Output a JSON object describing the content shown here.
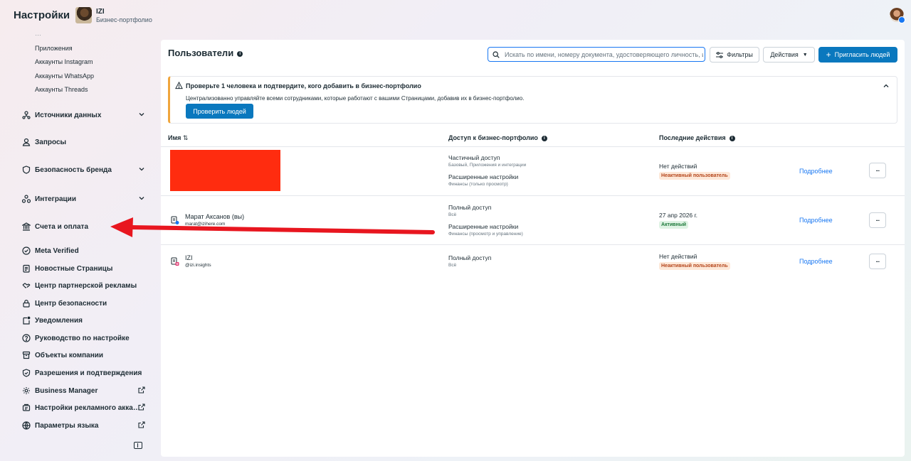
{
  "header": {
    "title": "Настройки",
    "business_name": "IZI",
    "business_type": "Бизнес-портфолио"
  },
  "sidebar": {
    "truncated_item": "…",
    "sub_items": [
      "Приложения",
      "Аккаунты Instagram",
      "Аккаунты WhatsApp",
      "Аккаунты Threads"
    ],
    "items": [
      {
        "label": "Источники данных",
        "icon": "data-sources-icon",
        "expandable": true
      },
      {
        "label": "Запросы",
        "icon": "person-icon"
      },
      {
        "label": "Безопасность бренда",
        "icon": "shield-icon",
        "expandable": true
      },
      {
        "label": "Интеграции",
        "icon": "integrations-icon",
        "expandable": true
      },
      {
        "label": "Счета и оплата",
        "icon": "bank-icon"
      },
      {
        "label": "Meta Verified",
        "icon": "verified-icon"
      },
      {
        "label": "Новостные Страницы",
        "icon": "news-icon"
      },
      {
        "label": "Центр партнерской рекламы",
        "icon": "handshake-icon"
      },
      {
        "label": "Центр безопасности",
        "icon": "lock-icon"
      },
      {
        "label": "Уведомления",
        "icon": "bell-icon"
      },
      {
        "label": "Руководство по настройке",
        "icon": "question-icon"
      },
      {
        "label": "Объекты компании",
        "icon": "archive-icon"
      },
      {
        "label": "Разрешения и подтверждения",
        "icon": "permissions-icon"
      },
      {
        "label": "Business Manager",
        "icon": "gear-icon",
        "external": true
      },
      {
        "label": "Настройки рекламного акка…",
        "icon": "ad-settings-icon",
        "external": true
      },
      {
        "label": "Параметры языка",
        "icon": "globe-icon",
        "external": true
      }
    ]
  },
  "users": {
    "title": "Пользователи",
    "search_placeholder": "Искать по имени, номеру документа, удостоверяющего личность, и",
    "filters_label": "Фильтры",
    "actions_label": "Действия",
    "invite_label": "Пригласить людей",
    "alert": {
      "title": "Проверьте 1 человека и подтвердите, кого добавить в бизнес-портфолио",
      "text": "Централизованно управляйте всеми сотрудниками, которые работают с вашими Страницами, добавив их в бизнес-портфолио.",
      "button": "Проверить людей"
    },
    "columns": {
      "name": "Имя",
      "access": "Доступ к бизнес-портфолио",
      "activity": "Последние действия"
    },
    "rows": [
      {
        "name": "",
        "email": "",
        "access_title": "Частичный доступ",
        "access_sub": "Базовый, Приложения и интеграции",
        "extra_title": "Расширенные настройки",
        "extra_sub": "Финансы (только просмотр)",
        "activity": "Нет действий",
        "status": "Неактивный пользователь",
        "details": "Подробнее",
        "more": "···"
      },
      {
        "name": "Марат Аксанов (вы)",
        "email": "marat@izihere.com",
        "access_title": "Полный доступ",
        "access_sub": "Всё",
        "extra_title": "Расширенные настройки",
        "extra_sub": "Финансы (просмотр и управление)",
        "activity": "27 апр 2026 г.",
        "status": "Активный",
        "details": "Подробнее",
        "more": "···"
      },
      {
        "name": "IZI",
        "email": "@izi.insights",
        "access_title": "Полный доступ",
        "access_sub": "Всё",
        "activity": "Нет действий",
        "status": "Неактивный пользователь",
        "details": "Подробнее",
        "more": "···"
      }
    ]
  },
  "colors": {
    "primary": "#0a78be",
    "annotation_arrow": "#e8161f",
    "redaction": "#ff2c0f",
    "warning": "#f0a53c"
  }
}
